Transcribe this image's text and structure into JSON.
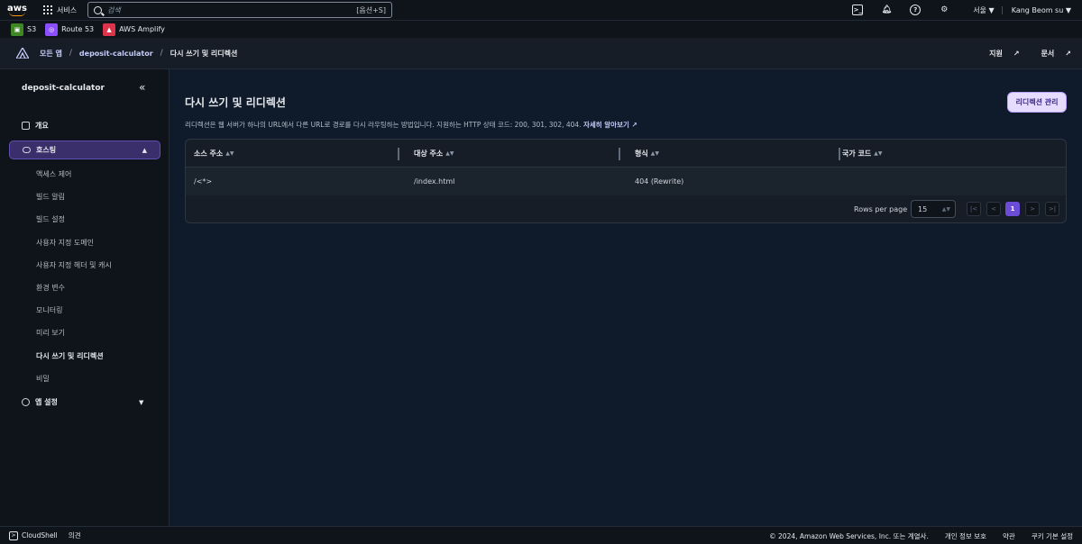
{
  "topnav": {
    "logo": "aws",
    "services": "서비스",
    "search_placeholder": "검색",
    "search_shortcut": "[옵션+S]",
    "region": "서울 ▼",
    "user": "Kang Beom su ▼"
  },
  "favorites": [
    {
      "label": "S3",
      "color": "#3f8624",
      "icon": "s3-icon"
    },
    {
      "label": "Route 53",
      "color": "#8c4fff",
      "icon": "route53-icon"
    },
    {
      "label": "AWS Amplify",
      "color": "#dd344c",
      "icon": "amplify-icon"
    }
  ],
  "breadcrumb": {
    "items": [
      "모든 앱",
      "deposit-calculator",
      "다시 쓰기 및 리디렉션"
    ],
    "support": "지원",
    "docs": "문서"
  },
  "sidebar": {
    "title": "deposit-calculator",
    "overview": "개요",
    "hosting": "호스팅",
    "sub_items": [
      "액세스 제어",
      "빌드 알림",
      "빌드 설정",
      "사용자 지정 도메인",
      "사용자 지정 헤더 및 캐시",
      "환경 변수",
      "모니터링",
      "미리 보기",
      "다시 쓰기 및 리디렉션",
      "비밀"
    ],
    "active_sub": "다시 쓰기 및 리디렉션",
    "app_settings": "앱 설정"
  },
  "main": {
    "title": "다시 쓰기 및 리디렉션",
    "manage_button": "리디렉션 관리",
    "description": "리디렉션은 웹 서버가 하나의 URL에서 다른 URL로 경로를 다시 라우팅하는 방법입니다. 지원하는 HTTP 상태 코드: 200, 301, 302, 404.",
    "learn_more": "자세히 알아보기",
    "table": {
      "columns": [
        "소스 주소",
        "대상 주소",
        "형식",
        "국가 코드"
      ],
      "rows": [
        [
          "/<*>",
          "/index.html",
          "404 (Rewrite)",
          ""
        ]
      ]
    },
    "pagination": {
      "rows_per_page_label": "Rows per page",
      "rows_per_page": "15",
      "current_page": "1"
    }
  },
  "footer": {
    "cloudshell": "CloudShell",
    "feedback": "의견",
    "copyright": "© 2024, Amazon Web Services, Inc. 또는 계열사.",
    "privacy": "개인 정보 보호",
    "terms": "약관",
    "cookies": "쿠키 기본 설정"
  }
}
